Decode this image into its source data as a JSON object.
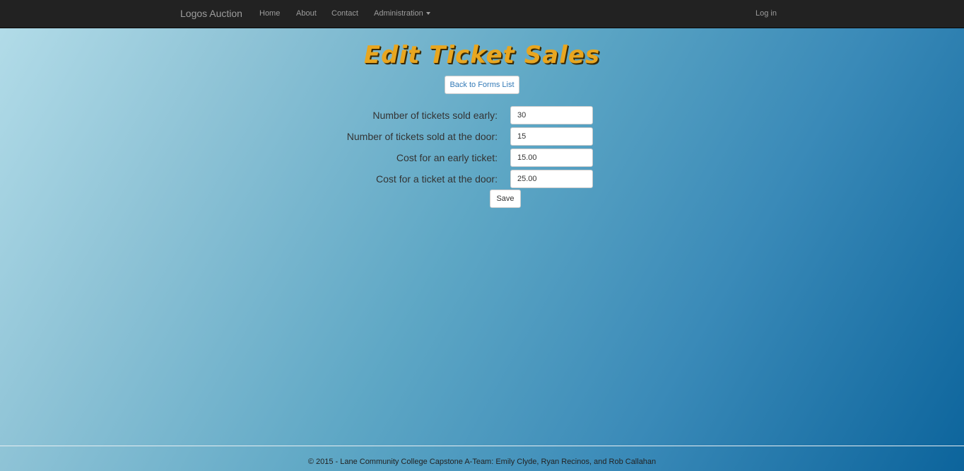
{
  "navbar": {
    "brand": "Logos Auction",
    "items": [
      {
        "label": "Home"
      },
      {
        "label": "About"
      },
      {
        "label": "Contact"
      },
      {
        "label": "Administration"
      }
    ],
    "login": "Log in"
  },
  "page": {
    "title": "Edit Ticket Sales",
    "back_button": "Back to Forms List"
  },
  "form": {
    "fields": [
      {
        "label": "Number of tickets sold early:",
        "value": "30"
      },
      {
        "label": "Number of tickets sold at the door:",
        "value": "15"
      },
      {
        "label": "Cost for an early ticket:",
        "value": "15.00"
      },
      {
        "label": "Cost for a ticket at the door:",
        "value": "25.00"
      }
    ],
    "save_label": "Save"
  },
  "footer": {
    "text": "© 2015 - Lane Community College Capstone A-Team: Emily Clyde, Ryan Recinos, and Rob Callahan"
  },
  "colors": {
    "navbar_bg": "#222222",
    "nav_text": "#9d9d9d",
    "title": "#e8a620",
    "link": "#337ab7"
  }
}
